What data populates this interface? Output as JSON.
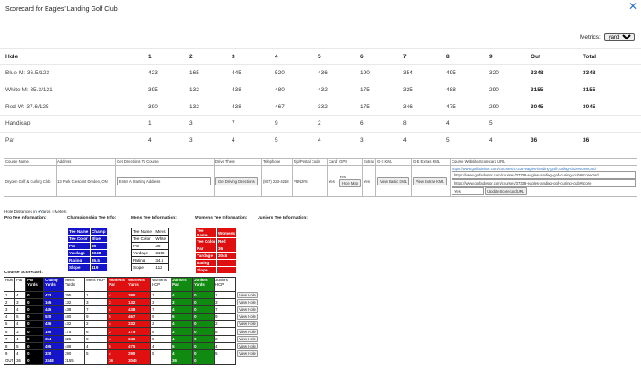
{
  "header": {
    "title": "Scorecard for Eagles' Landing Golf Club",
    "close_icon": "close-icon"
  },
  "metrics": {
    "label": "Metrics:",
    "selected": "yards"
  },
  "scorecard": {
    "columns": [
      "Hole",
      "1",
      "2",
      "3",
      "4",
      "5",
      "6",
      "7",
      "8",
      "9",
      "Out",
      "Total"
    ],
    "rows": [
      {
        "label": "Blue M: 36.5/123",
        "values": [
          "423",
          "165",
          "445",
          "520",
          "436",
          "190",
          "354",
          "495",
          "320",
          "3348",
          "3348"
        ]
      },
      {
        "label": "White M: 35.3/121",
        "values": [
          "395",
          "132",
          "438",
          "480",
          "432",
          "175",
          "325",
          "488",
          "290",
          "3155",
          "3155"
        ]
      },
      {
        "label": "Red W: 37.6/125",
        "values": [
          "390",
          "132",
          "438",
          "467",
          "332",
          "175",
          "346",
          "475",
          "290",
          "3045",
          "3045"
        ]
      },
      {
        "label": "Handicap",
        "values": [
          "1",
          "3",
          "7",
          "9",
          "2",
          "6",
          "8",
          "4",
          "5",
          "",
          ""
        ]
      },
      {
        "label": "Par",
        "values": [
          "4",
          "3",
          "4",
          "5",
          "4",
          "3",
          "4",
          "5",
          "4",
          "36",
          "36"
        ]
      }
    ]
  },
  "info": {
    "headers": [
      "Course Name",
      "Address",
      "Get Directions To Course",
      "Drive There",
      "Telephone",
      "Zip/Postal Code",
      "Card",
      "GPS",
      "Extras",
      "G-E KML",
      "G-E Extras KML",
      "Course Website/Scorecard URL"
    ],
    "course_name": "Dryden Golf & Curling Club",
    "address": "13 Park Crescent Dryden, ON",
    "directions_placeholder": "Enter A Starting Address",
    "drive_button": "Get Driving Directions",
    "telephone": "(807) 223-4218",
    "zip": "P8N2Y6",
    "card": "Yes",
    "gps": "Yes",
    "hole_map_button": "Hole Map",
    "extras": "Yes",
    "basic_kml_button": "View Basic KML",
    "extras_kml_button": "View Extras KML",
    "url_link": "https://www.golfadvisor.com/courses/37338-eagles-landing-golf-curling-club#scorecard",
    "url_field_1": "https://www.golfadvisor.com/courses/37338-eagles-landing-golf-curling-club#scorecard",
    "url_field_2": "https://www.golfadvisor.com/courses/37338-eagles-landing-golf-curling-club#score",
    "url_select": "Yes",
    "update_button": "UpdateScorecardURL"
  },
  "distances": {
    "label": "Hole Distances in",
    "opt_yards": "Yards",
    "opt_meters": "Meters"
  },
  "tee_info": {
    "pro": "Pro Tee Information:",
    "champ": "Championship Tee Info:",
    "mens": "Mens Tee Information:",
    "womens": "Womens Tee Information:",
    "juniors": "Juniors Tee Information:"
  },
  "tees": {
    "blue": [
      [
        "Tee Name",
        "Champ"
      ],
      [
        "Tee Color",
        "Blue"
      ],
      [
        "Par",
        "36"
      ],
      [
        "Yardage",
        "3348"
      ],
      [
        "Rating",
        "35.5"
      ],
      [
        "Slope",
        "119"
      ]
    ],
    "white": [
      [
        "Tee Name",
        "Mens"
      ],
      [
        "Tee Color",
        "White"
      ],
      [
        "Par",
        "36"
      ],
      [
        "Yardage",
        "3155"
      ],
      [
        "Rating",
        "34.5"
      ],
      [
        "Slope",
        "112"
      ]
    ],
    "red": [
      [
        "Tee Name",
        "Womens"
      ],
      [
        "Tee Color",
        "Red"
      ],
      [
        "Par",
        "36"
      ],
      [
        "Yardage",
        "3045"
      ],
      [
        "Rating",
        ""
      ],
      [
        "Slope",
        ""
      ]
    ]
  },
  "course_scorecard": {
    "title": "Course Scorecard:",
    "headers": [
      "Hole",
      "Par",
      "Pro Yards",
      "Champ Yards",
      "Mens Yards",
      "Mens HCP",
      "Womens Par",
      "Womens Yards",
      "Womens HCP",
      "Juniors Par",
      "Juniors Yards",
      "Juniors HCP"
    ],
    "view_label": "View Hole",
    "rows": [
      [
        "1",
        "4",
        "0",
        "423",
        "395",
        "1",
        "4",
        "390",
        "1",
        "4",
        "0",
        "1"
      ],
      [
        "2",
        "3",
        "0",
        "165",
        "132",
        "3",
        "3",
        "132",
        "3",
        "3",
        "0",
        "3"
      ],
      [
        "3",
        "4",
        "0",
        "445",
        "438",
        "7",
        "4",
        "438",
        "7",
        "4",
        "0",
        "7"
      ],
      [
        "4",
        "5",
        "0",
        "520",
        "480",
        "9",
        "5",
        "467",
        "9",
        "5",
        "0",
        "9"
      ],
      [
        "5",
        "4",
        "0",
        "436",
        "432",
        "2",
        "4",
        "332",
        "2",
        "4",
        "0",
        "2"
      ],
      [
        "6",
        "3",
        "0",
        "190",
        "175",
        "6",
        "3",
        "175",
        "6",
        "3",
        "0",
        "6"
      ],
      [
        "7",
        "4",
        "0",
        "354",
        "325",
        "8",
        "4",
        "346",
        "8",
        "4",
        "0",
        "8"
      ],
      [
        "8",
        "5",
        "0",
        "495",
        "488",
        "4",
        "5",
        "475",
        "4",
        "5",
        "0",
        "4"
      ],
      [
        "9",
        "4",
        "0",
        "320",
        "290",
        "5",
        "4",
        "290",
        "5",
        "4",
        "0",
        "5"
      ]
    ],
    "out": [
      "OUT",
      "36",
      "0",
      "3348",
      "3155",
      "",
      "36",
      "3045",
      "",
      "36",
      "0",
      ""
    ]
  }
}
